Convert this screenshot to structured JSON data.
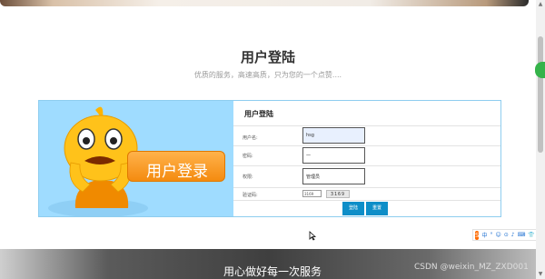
{
  "header": {
    "title": "用户登陆",
    "subtitle": "优质的服务，高速高质，只为您的一个点赞...."
  },
  "mascot": {
    "badge_text": "用户登录"
  },
  "login_form": {
    "heading": "用户登陆",
    "username": {
      "label": "用户名:",
      "value": "hsg"
    },
    "password": {
      "label": "密码:",
      "value": "一"
    },
    "role": {
      "label": "权限:",
      "value": "管理员"
    },
    "captcha": {
      "label": "验证码:",
      "input_value": "3169",
      "image_text": "3169"
    },
    "login_button": "登陆",
    "reset_button": "重置"
  },
  "ime_toolbar": {
    "logo": "S",
    "items": [
      "中",
      "°",
      "☺",
      "⊙",
      "♪",
      "⌨",
      "👕",
      "⁞⁞"
    ]
  },
  "footer": {
    "banner_text": "用心做好每一次服务",
    "watermark": "CSDN @weixin_MZ_ZXD001"
  },
  "colors": {
    "accent_blue": "#0e8ec8",
    "panel_border": "#8ecdef",
    "left_panel_bg": "#9fdcff",
    "mascot_orange": "#f48b10"
  }
}
